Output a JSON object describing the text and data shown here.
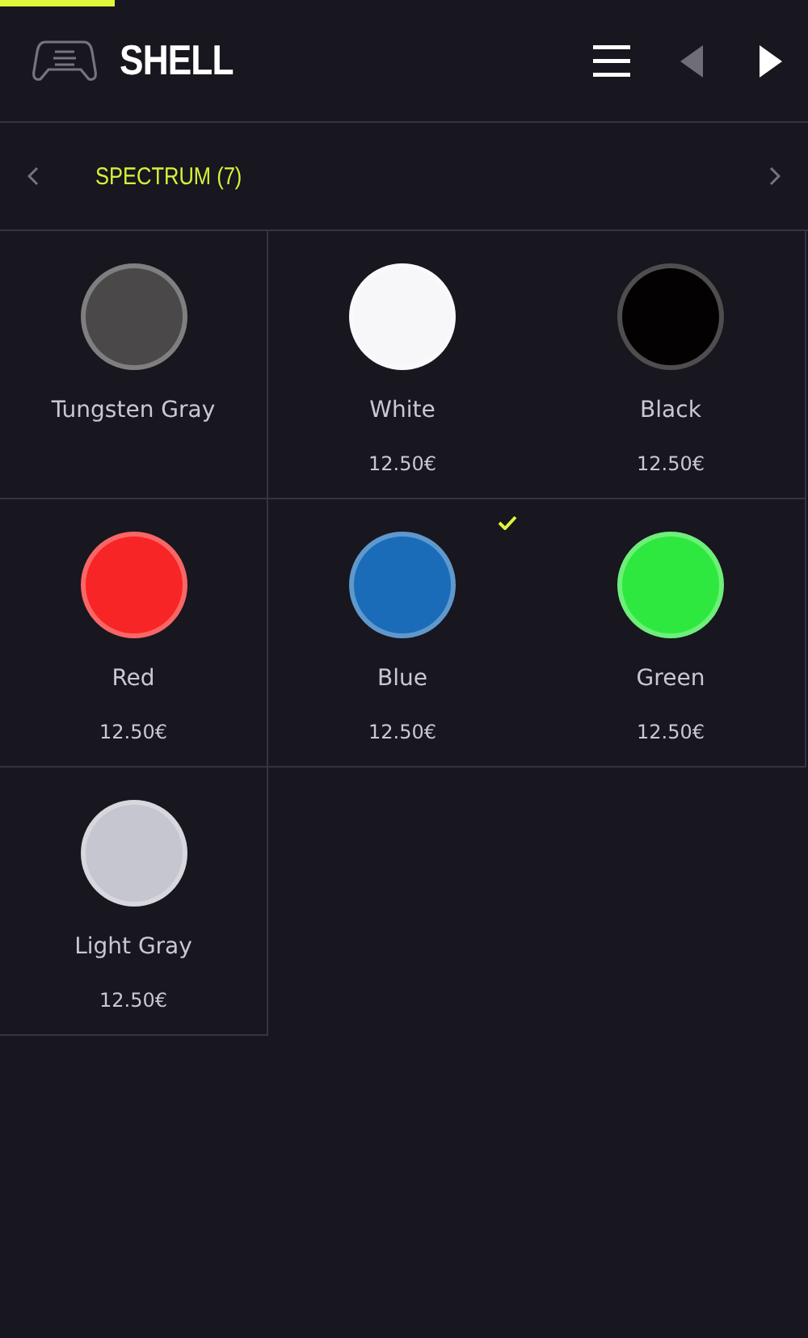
{
  "progress": {
    "level": 0.142
  },
  "header": {
    "title": "SHELL"
  },
  "category": {
    "label": "SPECTRUM (7)"
  },
  "swatches": [
    {
      "name": "Tungsten Gray",
      "color": "#4a4849",
      "selected": false
    },
    {
      "name": "White",
      "color": "#f7f7f9",
      "price": "12.50€",
      "selected": false
    },
    {
      "name": "Black",
      "color": "#030102",
      "price": "12.50€",
      "selected": false
    },
    {
      "name": "Red",
      "color": "#f72525",
      "price": "12.50€",
      "selected": false
    },
    {
      "name": "Blue",
      "color": "#1a6cb8",
      "price": "12.50€",
      "selected": true
    },
    {
      "name": "Green",
      "color": "#2ee83f",
      "price": "12.50€",
      "selected": false
    },
    {
      "name": "Light Gray",
      "color": "#c6c6d0",
      "price": "12.50€",
      "selected": false
    }
  ]
}
